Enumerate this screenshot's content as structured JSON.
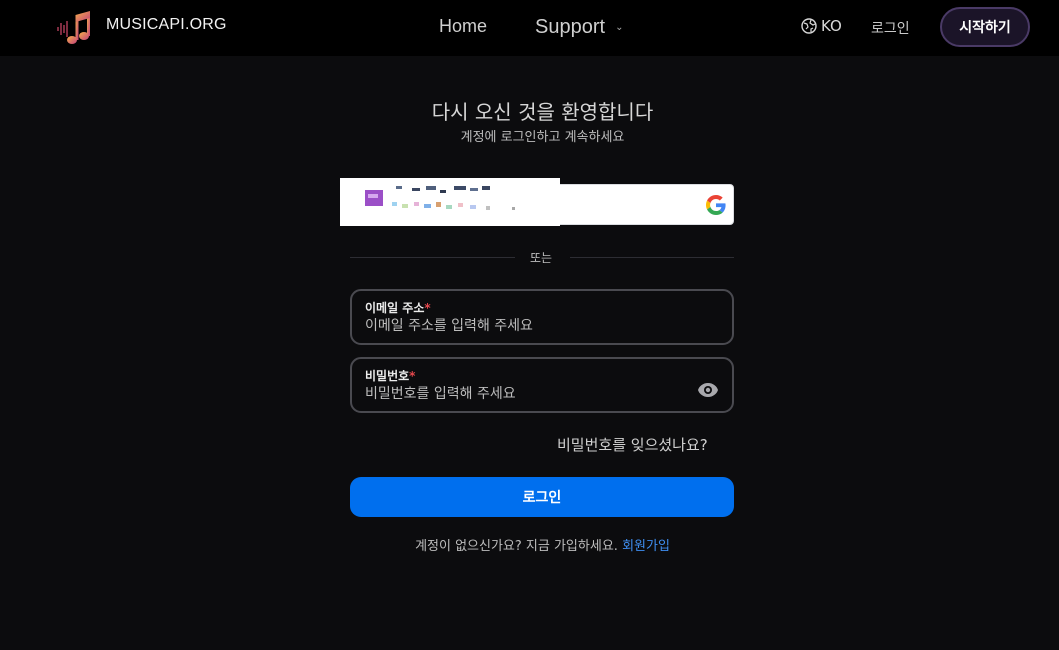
{
  "header": {
    "brand": "MUSICAPI.ORG",
    "logo_icon": "music-note-icon",
    "nav": {
      "home": "Home",
      "support": "Support"
    },
    "language": {
      "icon": "globe-icon",
      "code": "KO"
    },
    "login": "로그인",
    "start": "시작하기"
  },
  "main": {
    "title": "다시 오신 것을 환영합니다",
    "subtitle": "계정에 로그인하고 계속하세요",
    "google": {
      "icon": "google-g-icon"
    },
    "divider": "또는",
    "email": {
      "label": "이메일 주소",
      "required": "*",
      "placeholder": "이메일 주소를 입력해 주세요",
      "value": ""
    },
    "password": {
      "label": "비밀번호",
      "required": "*",
      "placeholder": "비밀번호를 입력해 주세요",
      "value": "",
      "toggle_icon": "eye-icon"
    },
    "forgot": "비밀번호를 잊으셨나요?",
    "login_button": "로그인",
    "signup_prompt": "계정이 없으신가요? 지금 가입하세요.",
    "signup_link": "회원가입"
  },
  "colors": {
    "background": "#0c0c0e",
    "header": "#000000",
    "primary": "#006fee",
    "link": "#3f8ef0",
    "required": "#e5484d"
  }
}
